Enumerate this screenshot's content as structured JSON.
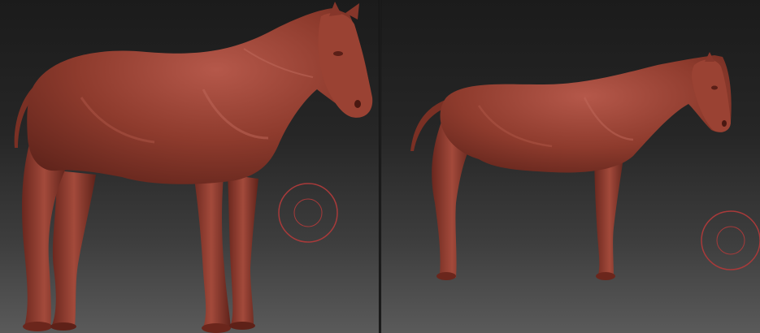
{
  "viewports": [
    {
      "view": "three-quarter-front",
      "model_color": "#8c3a2c",
      "brush_cursor_color": "#a83a3a"
    },
    {
      "view": "side-profile",
      "model_color": "#8c3a2c",
      "brush_cursor_color": "#a83a3a"
    }
  ],
  "background": {
    "top": "#1b1b1b",
    "bottom": "#5a5a5a"
  },
  "icons": [
    "brush-cursor-icon",
    "brush-cursor-icon"
  ]
}
